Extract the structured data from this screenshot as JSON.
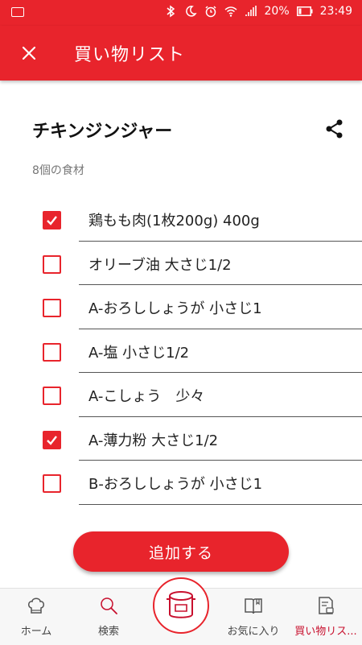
{
  "status_bar": {
    "battery": "20%",
    "time": "23:49"
  },
  "header": {
    "title": "買い物リスト"
  },
  "recipe": {
    "title": "チキンジンジャー",
    "ingredient_count": "8個の食材"
  },
  "ingredients": [
    {
      "label": "鶏もも肉(1枚200g) 400g",
      "checked": true
    },
    {
      "label": "オリーブ油 大さじ1/2",
      "checked": false
    },
    {
      "label": "A-おろししょうが 小さじ1",
      "checked": false
    },
    {
      "label": "A-塩 小さじ1/2",
      "checked": false
    },
    {
      "label": "A-こしょう　少々",
      "checked": false
    },
    {
      "label": "A-薄力粉 大さじ1/2",
      "checked": true
    },
    {
      "label": "B-おろししょうが 小さじ1",
      "checked": false
    }
  ],
  "add_button": {
    "label": "追加する"
  },
  "bottom_nav": {
    "home": "ホーム",
    "search": "検索",
    "favorites": "お気に入り",
    "shopping_list": "買い物リス..."
  },
  "colors": {
    "accent": "#e8242c"
  }
}
